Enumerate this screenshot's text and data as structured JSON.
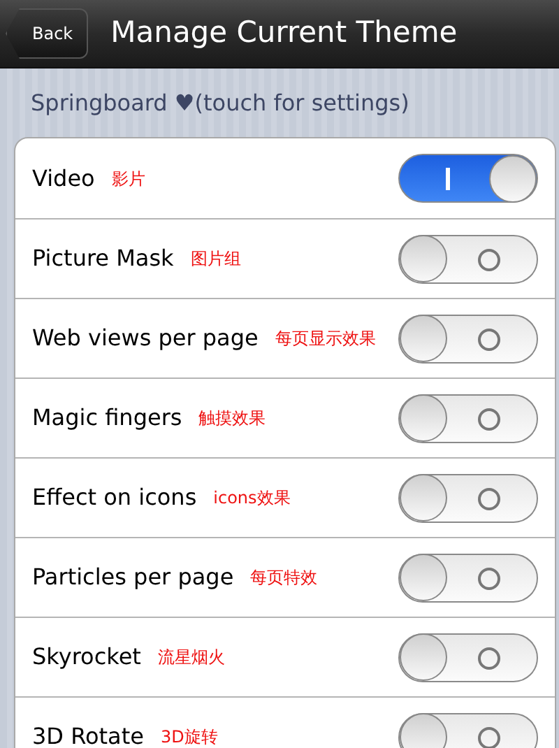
{
  "nav": {
    "back": "Back",
    "title": "Manage Current Theme"
  },
  "section": "Springboard ♥(touch for settings)",
  "rows": [
    {
      "label": "Video",
      "note": "影片",
      "on": true
    },
    {
      "label": "Picture Mask",
      "note": "图片组",
      "on": false
    },
    {
      "label": "Web views per page",
      "note": "每页显示效果",
      "on": false
    },
    {
      "label": "Magic fingers",
      "note": "触摸效果",
      "on": false
    },
    {
      "label": "Effect on icons",
      "note": "icons效果",
      "on": false
    },
    {
      "label": "Particles per page",
      "note": "每页特效",
      "on": false
    },
    {
      "label": "Skyrocket",
      "note": "流星烟火",
      "on": false
    },
    {
      "label": "3D Rotate",
      "note": "3D旋转",
      "on": false
    }
  ]
}
